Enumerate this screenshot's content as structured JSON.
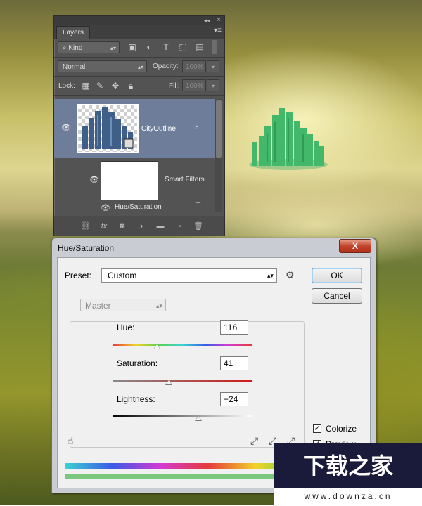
{
  "layers_panel": {
    "tab": "Layers",
    "filter_kind": "Kind",
    "blend_mode": "Normal",
    "opacity_label": "Opacity:",
    "opacity_value": "100%",
    "lock_label": "Lock:",
    "fill_label": "Fill:",
    "fill_value": "100%",
    "layers": [
      {
        "name": "CityOutline"
      },
      {
        "name": "Smart Filters"
      },
      {
        "name": "Hue/Saturation"
      }
    ]
  },
  "dialog": {
    "title": "Hue/Saturation",
    "close_label": "X",
    "preset_label": "Preset:",
    "preset_value": "Custom",
    "ok_label": "OK",
    "cancel_label": "Cancel",
    "channel": "Master",
    "hue_label": "Hue:",
    "hue_value": "116",
    "saturation_label": "Saturation:",
    "saturation_value": "41",
    "lightness_label": "Lightness:",
    "lightness_value": "+24",
    "colorize_label": "Colorize",
    "colorize_checked": true,
    "preview_label": "Preview",
    "preview_checked": true
  },
  "watermark": {
    "logo_text": "下载之家",
    "url": "www.downza.cn"
  },
  "colors": {
    "panel_bg": "#535353",
    "selected_layer": "#6e7d9a",
    "dialog_bg": "#f0f0f0",
    "close_red": "#c2442d",
    "colorize_result": "#7bc77d",
    "watermark_bg": "#1a1a3a"
  }
}
